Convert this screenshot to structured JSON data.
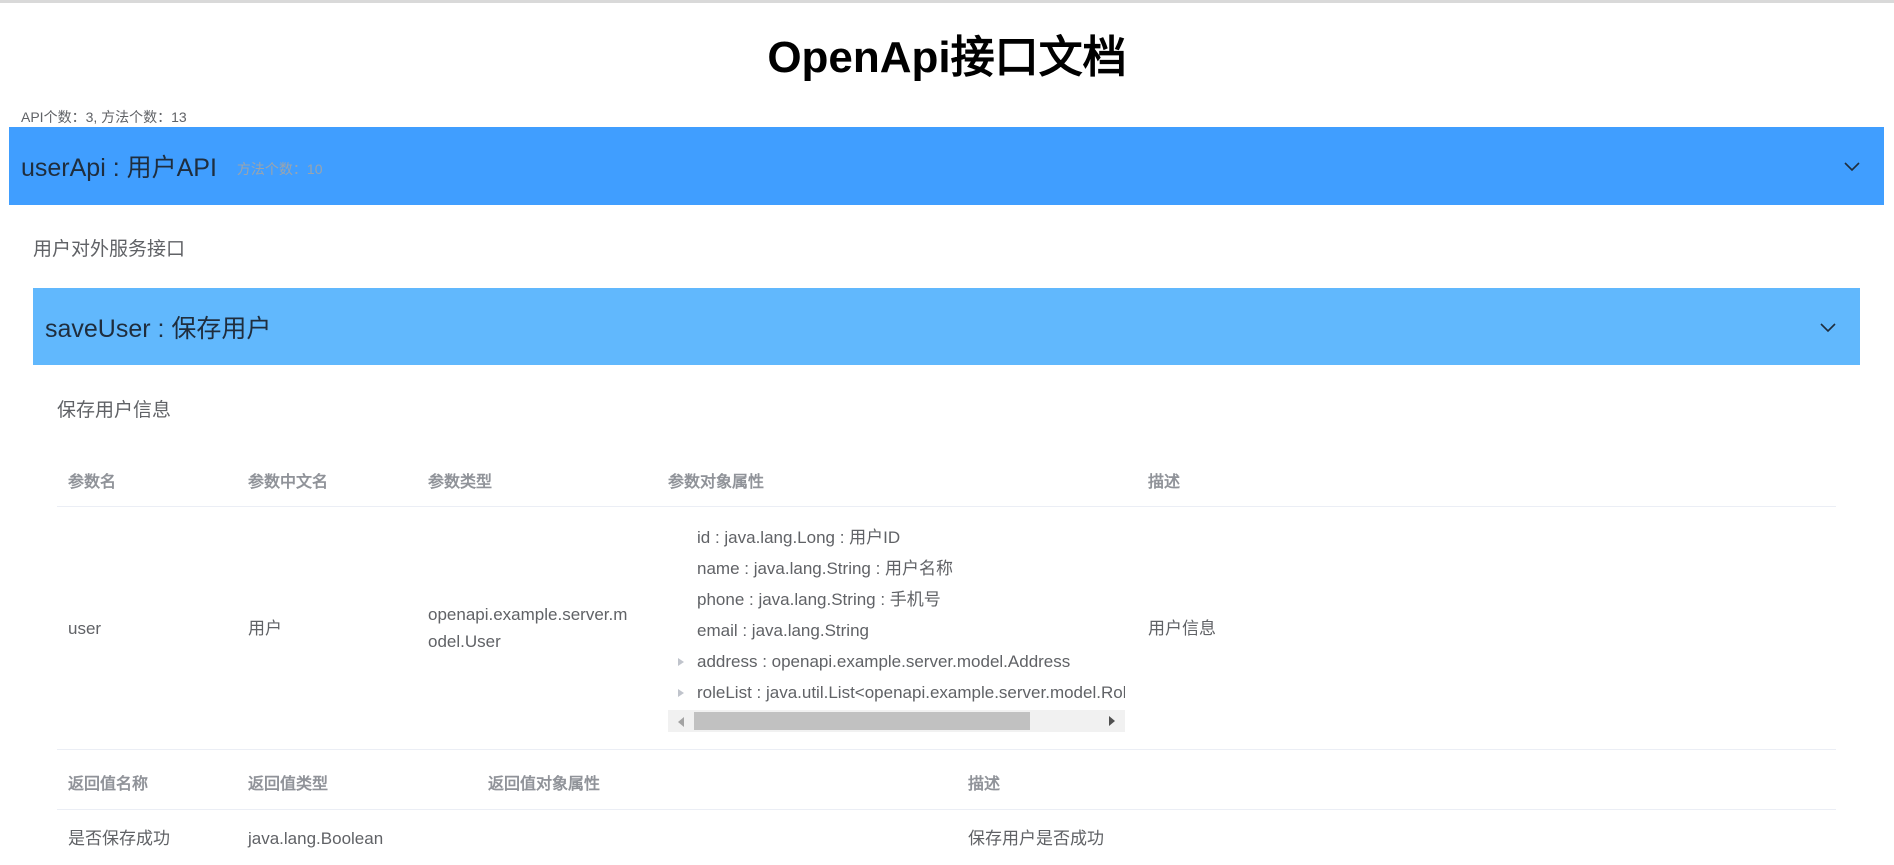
{
  "page": {
    "title": "OpenApi接口文档",
    "stats": "API个数：3, 方法个数：13"
  },
  "api": {
    "title": "userApi : 用户API",
    "method_count": "方法个数：10",
    "description": "用户对外服务接口",
    "header_color": "#409eff"
  },
  "method": {
    "title": "saveUser : 保存用户",
    "description": "保存用户信息",
    "header_color": "#61b8fd"
  },
  "params_table": {
    "headers": [
      "参数名",
      "参数中文名",
      "参数类型",
      "参数对象属性",
      "描述"
    ],
    "rows": [
      {
        "name": "user",
        "cn_name": "用户",
        "type": "openapi.example.server.model.User",
        "type_wrapped": [
          "openapi.example.server.m",
          "odel.User"
        ],
        "properties": [
          {
            "text": "id : java.lang.Long : 用户ID",
            "expandable": false
          },
          {
            "text": "name : java.lang.String : 用户名称",
            "expandable": false
          },
          {
            "text": "phone : java.lang.String : 手机号",
            "expandable": false
          },
          {
            "text": "email : java.lang.String",
            "expandable": false
          },
          {
            "text": "address : openapi.example.server.model.Address",
            "expandable": true
          },
          {
            "text": "roleList : java.util.List<openapi.example.server.model.Role>",
            "expandable": true
          }
        ],
        "description": "用户信息"
      }
    ]
  },
  "return_table": {
    "headers": [
      "返回值名称",
      "返回值类型",
      "返回值对象属性",
      "描述"
    ],
    "rows": [
      {
        "name": "是否保存成功",
        "type": "java.lang.Boolean",
        "properties": "",
        "description": "保存用户是否成功"
      }
    ]
  },
  "icons": {
    "collapse": "chevron-down-icon",
    "tree_expand": "caret-right-icon"
  }
}
